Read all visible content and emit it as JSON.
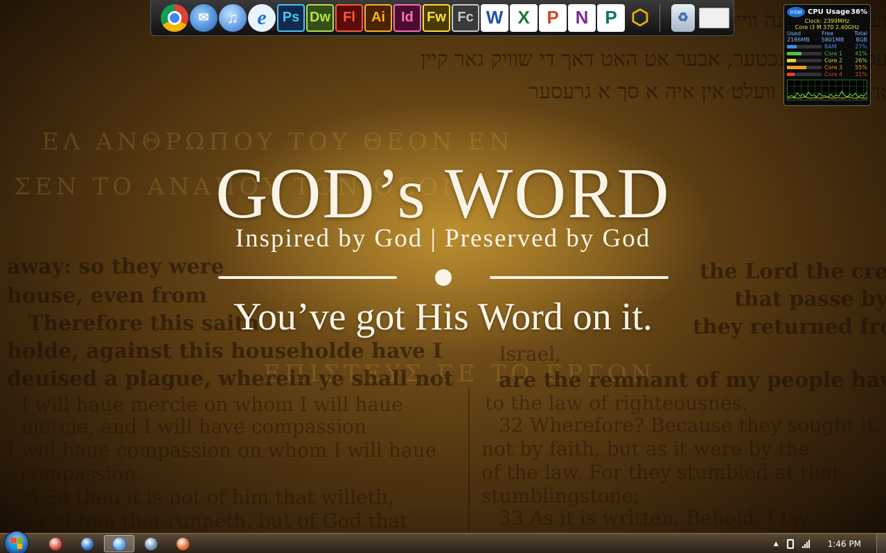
{
  "wallpaper": {
    "title": "GOD’s WORD",
    "subtitle": "Inspired by God | Preserved by God",
    "tagline": "You’ve got His Word on it.",
    "hebrew_lines": [
      "וועגן דער מתונה ווייסן מען דאס א",
      "יעס דער גערעכטער, אבער אט האט דאך די שוויק גאר קיין",
      "אהוא אין דער וועלט אין איה א סך א גרעסער"
    ],
    "greek_lines": [
      "ΕΛ ΑΝΘΡΩΠΟΥ ΤΟΥ ΘΕΟΝ ΕΝ",
      "ΣΕΝ ΤΟ ΑΝΑΠΟΥ ΤΟΝ ΘΕΟΝ",
      "ΕΠΙΣΤΕΥΣ ΓΕ ΤΟ ΕΡΓΟΝ"
    ],
    "old_lines_left": [
      "away: so they were",
      "house, even from",
      "Therefore this saith",
      "holde, against this householde have I",
      "deuised a plague, wherein ye shall not",
      "I will haue mercie on whom I will haue",
      "mercie, and I will have compassion",
      "I will haue compassion on whom I will haue",
      "compassion.",
      "16 So then it is not of him that willeth,",
      "nor of him that runneth, but of God that"
    ],
    "old_lines_right": [
      "the Lord the creatio",
      "that passe by pe",
      "they returned from o",
      "Israel,",
      "are the remnant of my people have",
      "to the law of righteousnes.",
      "32 Wherefore? Because they sought it",
      "not by faith, but as it were by the",
      "of the law. For they stumbled at that",
      "stumblingstone;",
      "33 As it is written, Behold, I lay"
    ]
  },
  "dock": {
    "icons": [
      {
        "name": "chrome-icon",
        "label": ""
      },
      {
        "name": "thunderbird-icon",
        "label": "✉"
      },
      {
        "name": "itunes-icon",
        "label": "♫"
      },
      {
        "name": "internet-explorer-icon",
        "label": "e"
      },
      {
        "name": "photoshop-icon",
        "label": "Ps"
      },
      {
        "name": "dreamweaver-icon",
        "label": "Dw"
      },
      {
        "name": "flash-icon",
        "label": "Fl"
      },
      {
        "name": "illustrator-icon",
        "label": "Ai"
      },
      {
        "name": "indesign-icon",
        "label": "Id"
      },
      {
        "name": "fireworks-icon",
        "label": "Fw"
      },
      {
        "name": "flash-catalyst-icon",
        "label": "Fc"
      },
      {
        "name": "word-icon",
        "label": "W"
      },
      {
        "name": "excel-icon",
        "label": "X"
      },
      {
        "name": "powerpoint-icon",
        "label": "P"
      },
      {
        "name": "onenote-icon",
        "label": "N"
      },
      {
        "name": "publisher-icon",
        "label": "P"
      },
      {
        "name": "virtualbox-icon",
        "label": "⬡"
      }
    ],
    "recycle_label": "♻"
  },
  "cpu_gadget": {
    "title": "CPU Usage",
    "usage": "36%",
    "clock": "Clock: 2399MHz",
    "model": "Core i3 M 370 2.40GHz",
    "mem_headers": [
      "Used",
      "Free",
      "Total"
    ],
    "mem_values": [
      "2186MB",
      "5801MB",
      "8GB"
    ],
    "rows": [
      {
        "name": "RAM",
        "value": "27%",
        "level": 0.27,
        "color": "#3d8ee8"
      },
      {
        "name": "Core 1",
        "value": "41%",
        "level": 0.41,
        "color": "#49c04a"
      },
      {
        "name": "Core 2",
        "value": "26%",
        "level": 0.26,
        "color": "#d8d83a"
      },
      {
        "name": "Core 3",
        "value": "55%",
        "level": 0.55,
        "color": "#f09a1a"
      },
      {
        "name": "Core 4",
        "value": "21%",
        "level": 0.21,
        "color": "#e0442a"
      }
    ]
  },
  "taskbar": {
    "buttons": [
      {
        "name": "taskbar-chrome",
        "color": "#db4437",
        "active": false
      },
      {
        "name": "taskbar-thunderbird",
        "color": "#2a6fd0",
        "active": false
      },
      {
        "name": "taskbar-itunes",
        "color": "#4fa3ff",
        "active": true
      },
      {
        "name": "taskbar-virtualbox",
        "color": "#6d8fb5",
        "active": false
      },
      {
        "name": "taskbar-firefox",
        "color": "#e8652a",
        "active": false
      }
    ],
    "tray_arrow": "▲",
    "clock": "1:46 PM"
  }
}
